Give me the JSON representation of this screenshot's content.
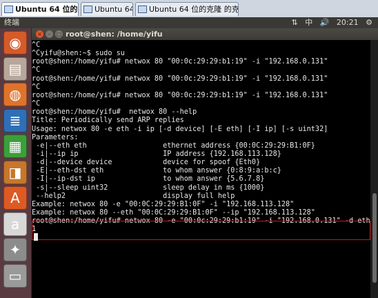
{
  "vmware_tabs": [
    {
      "label": "Ubuntu 64 位的克隆",
      "active": true
    },
    {
      "label": "Ubuntu 64",
      "active": false
    },
    {
      "label": "Ubuntu 64 位的克隆 的克隆",
      "active": false
    }
  ],
  "top_panel": {
    "app_name": "终端",
    "tray": {
      "network": "⇅",
      "input_method": "中",
      "volume": "🔊",
      "time": "20:21",
      "settings": "⚙"
    }
  },
  "launcher": {
    "items": [
      {
        "name": "dash-home-icon",
        "glyph": "◉",
        "color": "#d65a2a"
      },
      {
        "name": "files-icon",
        "glyph": "▤",
        "color": "#b7a79a"
      },
      {
        "name": "firefox-icon",
        "glyph": "◍",
        "color": "#e0732c"
      },
      {
        "name": "writer-icon",
        "glyph": "≣",
        "color": "#2f6fb5"
      },
      {
        "name": "calc-icon",
        "glyph": "▦",
        "color": "#3b9f3b"
      },
      {
        "name": "impress-icon",
        "glyph": "◨",
        "color": "#c6772b"
      },
      {
        "name": "software-center-icon",
        "glyph": "A",
        "color": "#dd5a25"
      },
      {
        "name": "amazon-icon",
        "glyph": "a",
        "color": "#d8d8d8"
      },
      {
        "name": "system-settings-icon",
        "glyph": "✦",
        "color": "#8c8c8c"
      },
      {
        "name": "printer-icon",
        "glyph": "▭",
        "color": "#9a9a9a"
      }
    ]
  },
  "terminal": {
    "title": "root@shen: /home/yifu",
    "lines": [
      "^C",
      "^Cyifu@shen:~$ sudo su",
      "root@shen:/home/yifu# netwox 80 \"00:0c:29:29:b1:19\" -i \"192.168.0.131\"",
      "^C",
      "root@shen:/home/yifu# netwox 80 \"00:0c:29:29:b1:19\" -i \"192.168.0.131\"",
      "^C",
      "root@shen:/home/yifu# netwox 80 \"00:0c:29:29:b1:19\" -i \"192.168.0.131\"",
      "^C",
      "root@shen:/home/yifu#  netwox 80 --help",
      "Title: Periodically send ARP replies",
      "Usage: netwox 80 -e eth -i ip [-d device] [-E eth] [-I ip] [-s uint32]",
      "Parameters:",
      " -e|--eth eth                  ethernet address {00:0C:29:29:B1:0F}",
      " -i|--ip ip                    IP address {192.168.113.128}",
      " -d|--device device            device for spoof {Eth0}",
      " -E|--eth-dst eth              to whom answer {0:8:9:a:b:c}",
      " -I|--ip-dst ip                to whom answer {5.6.7.8}",
      " -s|--sleep uint32             sleep delay in ms {1000}",
      " --help2                       display full help",
      "Example: netwox 80 -e \"00:0C:29:29:B1:0F\" -i \"192.168.113.128\"",
      "Example: netwox 80 --eth \"00:0C:29:29:B1:0F\" --ip \"192.168.113.128\"",
      "root@shen:/home/yifu# netwox 80 -e \"00:0c:29:29:b1:19\" -i \"192.168.0.131\" -d eth",
      "1"
    ]
  }
}
